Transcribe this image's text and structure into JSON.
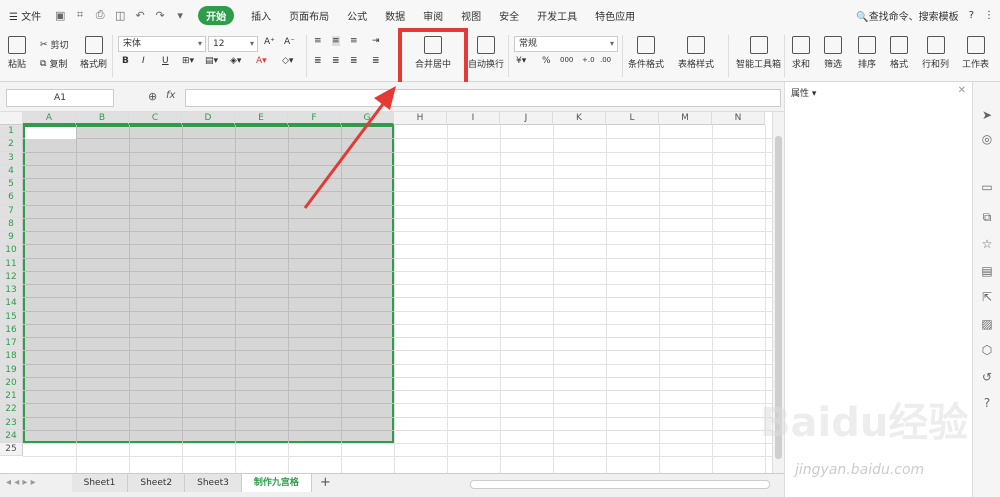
{
  "menubar": {
    "file": "☰ 文件",
    "tabs": [
      "开始",
      "插入",
      "页面布局",
      "公式",
      "数据",
      "审阅",
      "视图",
      "安全",
      "开发工具",
      "特色应用"
    ],
    "active_tab": "开始",
    "search": "查找命令、搜索模板",
    "help": "?",
    "more": "⋮"
  },
  "ribbon": {
    "paste": "粘贴",
    "cut": "剪切",
    "copy": "复制",
    "format_painter": "格式刷",
    "font_name": "宋体",
    "font_size": "12",
    "merge_center": "合并居中",
    "wrap_text": "自动换行",
    "number_format": "常规",
    "conditional_format": "条件格式",
    "table_style": "表格样式",
    "smart_toolbox": "智能工具箱",
    "sum": "求和",
    "filter": "筛选",
    "sort": "排序",
    "format": "格式",
    "row_col": "行和列",
    "worksheet": "工作表",
    "bold": "B",
    "italic": "I",
    "underline": "U",
    "percent": "%",
    "thousands": "000"
  },
  "formula_bar": {
    "name_box": "A1",
    "fx": "fx"
  },
  "columns": [
    "A",
    "B",
    "C",
    "D",
    "E",
    "F",
    "G",
    "H",
    "I",
    "J",
    "K",
    "L",
    "M",
    "N"
  ],
  "rows": [
    "1",
    "2",
    "3",
    "4",
    "5",
    "6",
    "7",
    "8",
    "9",
    "10",
    "11",
    "12",
    "13",
    "14",
    "15",
    "16",
    "17",
    "18",
    "19",
    "20",
    "21",
    "22",
    "23",
    "24",
    "25"
  ],
  "sheets": [
    "Sheet1",
    "Sheet2",
    "Sheet3",
    "制作九宫格"
  ],
  "active_sheet": "制作九宫格",
  "pane": {
    "title": "属性 ▾"
  },
  "watermark": {
    "brand": "Baidu经验",
    "url": "jingyan.baidu.com"
  },
  "colors": {
    "accent": "#2e9d4a",
    "highlight": "#e53935"
  }
}
